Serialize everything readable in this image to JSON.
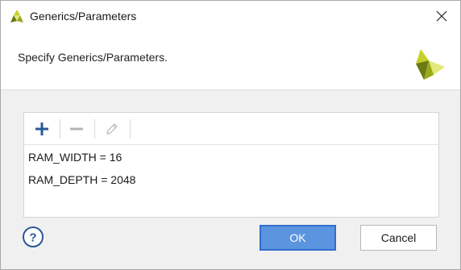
{
  "window": {
    "title": "Generics/Parameters"
  },
  "header": {
    "instruction": "Specify Generics/Parameters."
  },
  "toolbar": {
    "add_icon": "plus-icon",
    "remove_icon": "minus-icon",
    "edit_icon": "pencil-icon"
  },
  "parameters": [
    {
      "text": "RAM_WIDTH = 16"
    },
    {
      "text": "RAM_DEPTH = 2048"
    }
  ],
  "buttons": {
    "help_icon": "help-icon",
    "ok_label": "OK",
    "cancel_label": "Cancel"
  },
  "colors": {
    "accent": "#2b5797",
    "ok_background": "#5b94df",
    "logo_green": "#c5d12a",
    "logo_dark": "#6b7a12"
  }
}
